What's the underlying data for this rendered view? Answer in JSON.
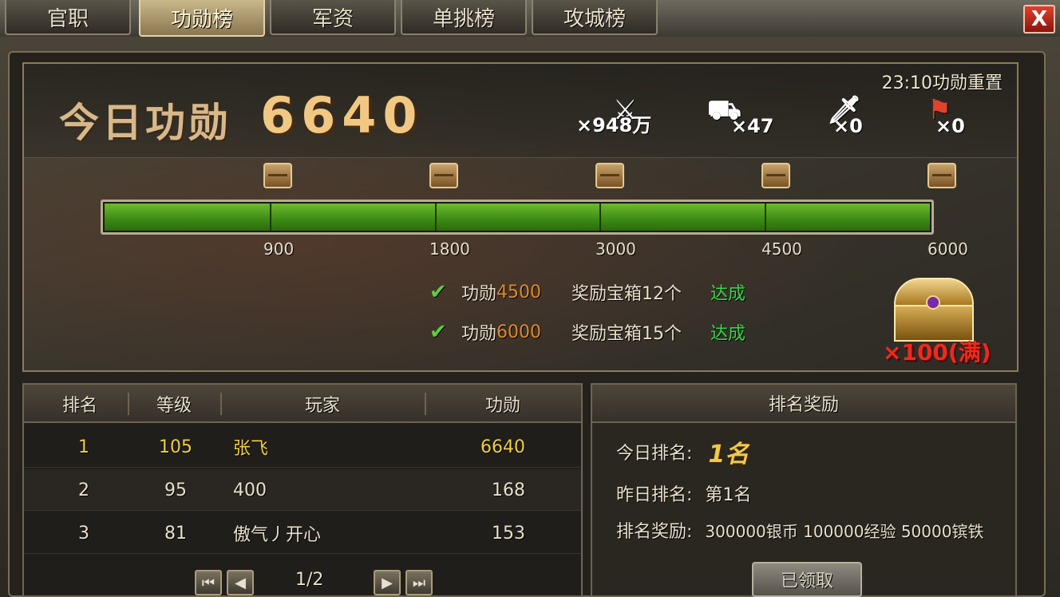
{
  "tabs": [
    {
      "label": "官职"
    },
    {
      "label": "功勋榜"
    },
    {
      "label": "军资"
    },
    {
      "label": "单挑榜"
    },
    {
      "label": "攻城榜"
    }
  ],
  "close_label": "X",
  "reset_text": "23:10功勋重置",
  "today": {
    "label": "今日功勋",
    "value": "6640"
  },
  "resources": [
    {
      "icon": "soldier-icon",
      "value": "×948万"
    },
    {
      "icon": "tank-icon",
      "value": "×47"
    },
    {
      "icon": "warrior-icon",
      "value": "×0"
    },
    {
      "icon": "flag-icon",
      "value": "×0"
    }
  ],
  "progress": {
    "value": 6640,
    "max": 6000,
    "fill_fraction": 1.0,
    "ticks": [
      "900",
      "1800",
      "3000",
      "4500",
      "6000"
    ]
  },
  "milestones": [
    {
      "label": "功勋",
      "threshold": "4500",
      "reward": "奖励宝箱12个",
      "status": "达成"
    },
    {
      "label": "功勋",
      "threshold": "6000",
      "reward": "奖励宝箱15个",
      "status": "达成"
    }
  ],
  "chest_count": "×100(满)",
  "board": {
    "headers": [
      "排名",
      "等级",
      "玩家",
      "功勋"
    ],
    "rows": [
      {
        "rank": "1",
        "level": "105",
        "player": "张飞",
        "merit": "6640"
      },
      {
        "rank": "2",
        "level": "95",
        "player": "400",
        "merit": "168"
      },
      {
        "rank": "3",
        "level": "81",
        "player": "傲气丿开心",
        "merit": "153"
      }
    ],
    "page": "1/2"
  },
  "rank_reward": {
    "title": "排名奖励",
    "today_label": "今日排名:",
    "today_value": "1名",
    "yesterday_label": "昨日排名:",
    "yesterday_value": "第1名",
    "reward_label": "排名奖励:",
    "reward_value": "300000银币  100000经验  50000镔铁",
    "claim_label": "已领取"
  }
}
